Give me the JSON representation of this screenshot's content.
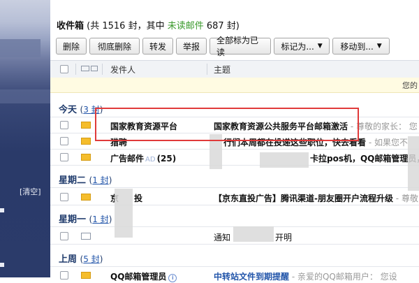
{
  "sidebar": {
    "clear_label": "[清空]"
  },
  "title": {
    "folder": "收件箱",
    "count_prefix": " (共 1516 封，其中 ",
    "unread_label": "未读邮件",
    "count_suffix": " 687 封)"
  },
  "toolbar": {
    "delete": "删除",
    "delete_permanent": "彻底删除",
    "forward": "转发",
    "report": "举报",
    "mark_all_read": "全部标为已读",
    "mark_as": "标记为...",
    "move_to": "移动到..."
  },
  "table_header": {
    "sender": "发件人",
    "subject": "主题"
  },
  "notice": {
    "text": "您的"
  },
  "groups": [
    {
      "label": "今天",
      "count": "3 封"
    },
    {
      "label": "星期二",
      "count": "1 封"
    },
    {
      "label": "星期一",
      "count": "1 封"
    },
    {
      "label": "上周",
      "count": "5 封"
    }
  ],
  "rows": [
    {
      "sender": "国家教育资源平台",
      "subject": "国家教育资源公共服务平台邮箱激活",
      "preview": " - 尊敬的家长：  您"
    },
    {
      "sender": "猎聘",
      "subject": "行们本周都在投递这些职位，快去看看",
      "preview": " - 如果您不"
    },
    {
      "sender": "广告邮件",
      "ad": "AD",
      "count": "(25)",
      "subject": "卡拉pos机，QQ邮箱管理员，"
    },
    {
      "sender": "京",
      "sender2": "投",
      "subject": "【京东直投广告】腾讯渠道-朋友圈开户流程升级",
      "preview": " - 尊敬"
    },
    {
      "sender": "",
      "subject": "通知",
      "subject2": "开明"
    },
    {
      "sender": "QQ邮箱管理员",
      "subject": "中转站文件到期提醒",
      "preview": " - 亲爱的QQ邮箱用户：  您设"
    }
  ]
}
